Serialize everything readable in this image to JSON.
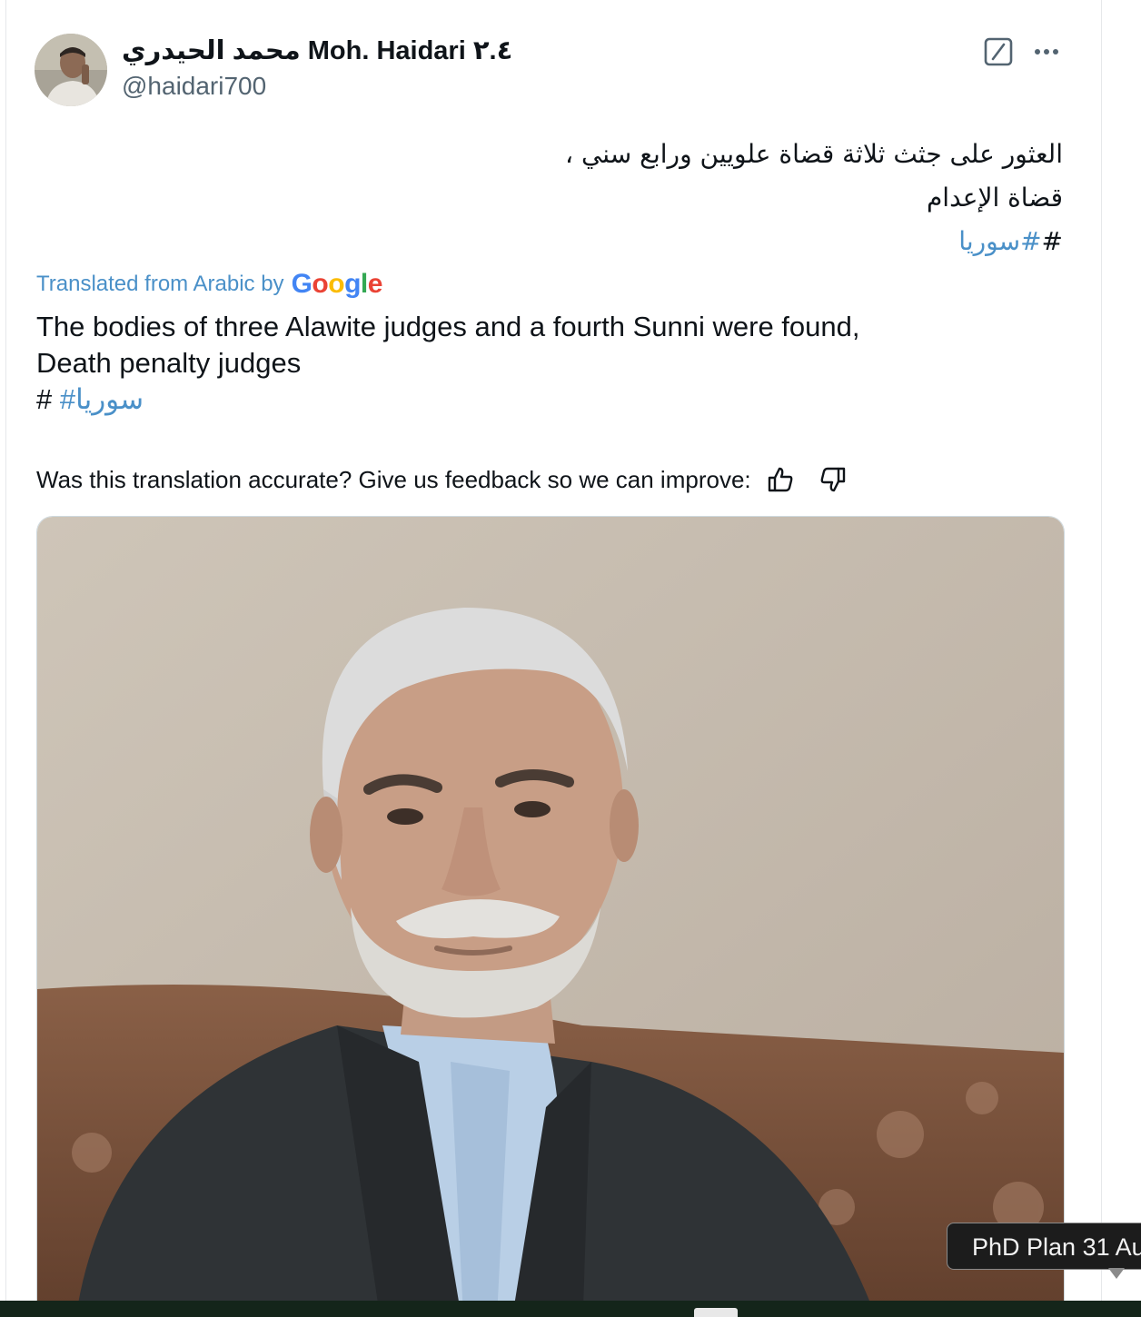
{
  "author": {
    "display_name": "محمد الحيدري Moh. Haidari ٢.٤",
    "handle": "@haidari700"
  },
  "icons": {
    "avatar": "avatar",
    "grok": "grok-icon",
    "more": "more-icon",
    "thumbs_up": "thumbs-up-icon",
    "thumbs_down": "thumbs-down-icon",
    "google_logo": "google-logo"
  },
  "post": {
    "arabic_lines": [
      "العثور على جثث ثلاثة قضاة علويين ورابع سني ،",
      "قضاة الإعدام"
    ],
    "arabic_hash_prefix": "#",
    "arabic_hashtag": "#سوريا"
  },
  "translation": {
    "label": "Translated from Arabic by",
    "google_logo_text": "Google",
    "lines": [
      "The bodies of three Alawite judges and a fourth Sunni were found,",
      "Death penalty judges"
    ],
    "hash_prefix": "#",
    "hashtag": "#سوريا"
  },
  "feedback": {
    "prompt": "Was this translation accurate? Give us feedback so we can improve:"
  },
  "tooltip": {
    "text": "PhD Plan 31 Au"
  },
  "colors": {
    "link": "#4a90c8",
    "text": "#0f1419",
    "muted": "#536471",
    "tooltip_bg": "#1c1c1c"
  }
}
